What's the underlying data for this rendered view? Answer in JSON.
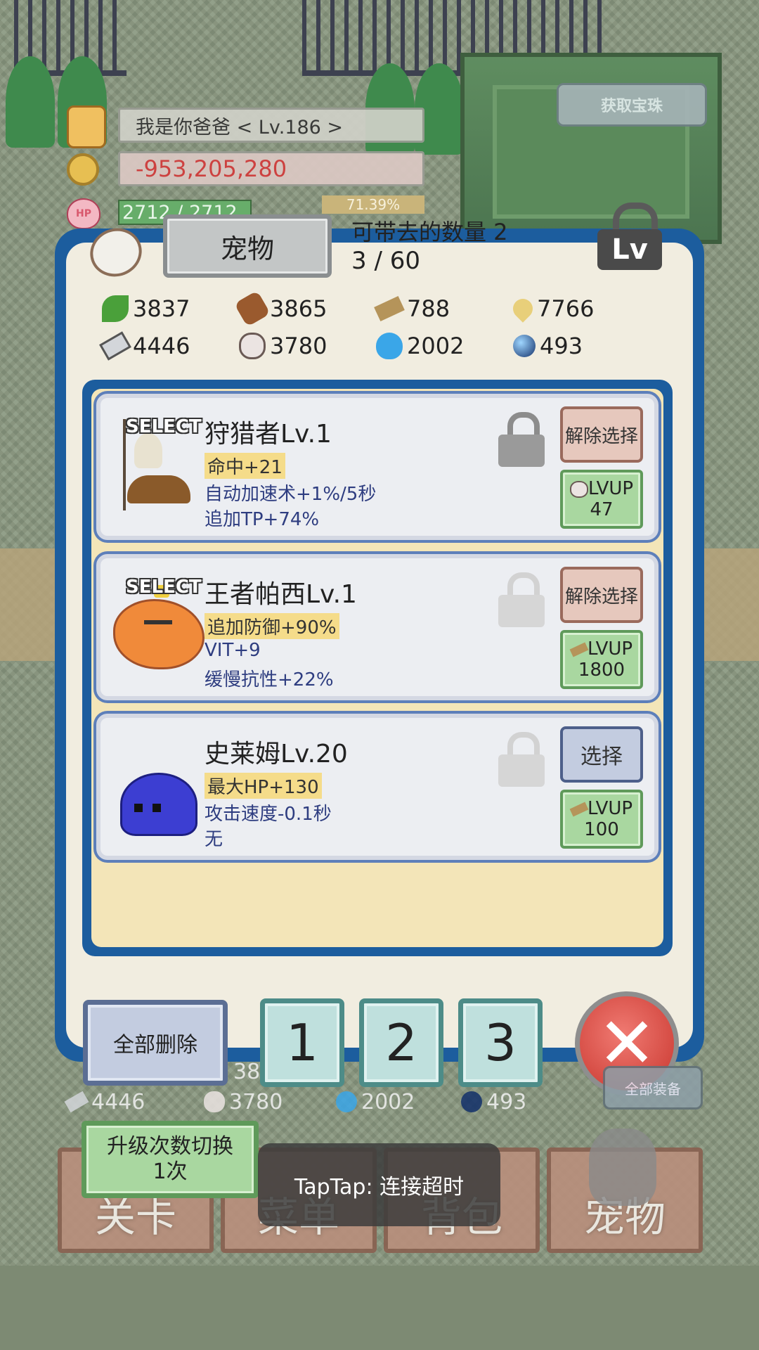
{
  "player": {
    "name_level": "我是你爸爸    < Lv.186 >",
    "gold": "-953,205,280",
    "hp": "2712 / 2712",
    "exp_percent": "71.39%",
    "get_gem_label": "获取宝珠"
  },
  "panel": {
    "title": "宠物",
    "carry_label": "可带去的数量 2",
    "pet_count": "3 / 60",
    "lv_lock_label": "Lv"
  },
  "resources": [
    {
      "icon": "leaf-icon",
      "value": "3837"
    },
    {
      "icon": "log-icon",
      "value": "3865"
    },
    {
      "icon": "plank-icon",
      "value": "788"
    },
    {
      "icon": "drop-icon",
      "value": "7766"
    },
    {
      "icon": "iron-ingot-icon",
      "value": "4446"
    },
    {
      "icon": "stone-icon",
      "value": "3780"
    },
    {
      "icon": "blue-flame-icon",
      "value": "2002"
    },
    {
      "icon": "orb-icon",
      "value": "493"
    }
  ],
  "pets": [
    {
      "select_tag": "SELECT",
      "name": "狩猎者Lv.1",
      "line1": "命中+21",
      "line2": "自动加速术+1%/5秒",
      "line3": "追加TP+74%",
      "locked": true,
      "action_label": "解除选择",
      "lvup_label": "LVUP",
      "lvup_cost": "47",
      "lvup_icon": "stone-icon"
    },
    {
      "select_tag": "SELECT",
      "name": "王者帕西Lv.1",
      "line1": "追加防御+90%",
      "line2": "VIT+9",
      "line3": "缓慢抗性+22%",
      "locked": false,
      "action_label": "解除选择",
      "lvup_label": "LVUP",
      "lvup_cost": "1800",
      "lvup_icon": "plank-icon"
    },
    {
      "select_tag": "",
      "name": "史莱姆Lv.20",
      "line1": "最大HP+130",
      "line2": "攻击速度-0.1秒",
      "line3": "无",
      "locked": false,
      "action_label": "选择",
      "lvup_label": "LVUP",
      "lvup_cost": "100",
      "lvup_icon": "plank-icon"
    }
  ],
  "bottom": {
    "delete_all": "全部删除",
    "slots": [
      "1",
      "2",
      "3"
    ],
    "close_icon": "close-icon"
  },
  "background": {
    "partial_number": "38",
    "res": [
      "4446",
      "3780",
      "2002",
      "493"
    ],
    "equip_all": "全部装备",
    "upgrade_toggle_line1": "升级次数切换",
    "upgrade_toggle_line2": "1次",
    "nav": [
      "关卡",
      "菜单",
      "背包",
      "宠物"
    ]
  },
  "toast": "TapTap: 连接超时",
  "colors": {
    "panel_frame": "#1c5d9e",
    "panel_bg": "#f1ede0",
    "gold_negative": "#d33b3b",
    "lvup_green": "#a9d7a0",
    "deselect_red": "#e6c8bd",
    "select_blue": "#c3cce0"
  }
}
